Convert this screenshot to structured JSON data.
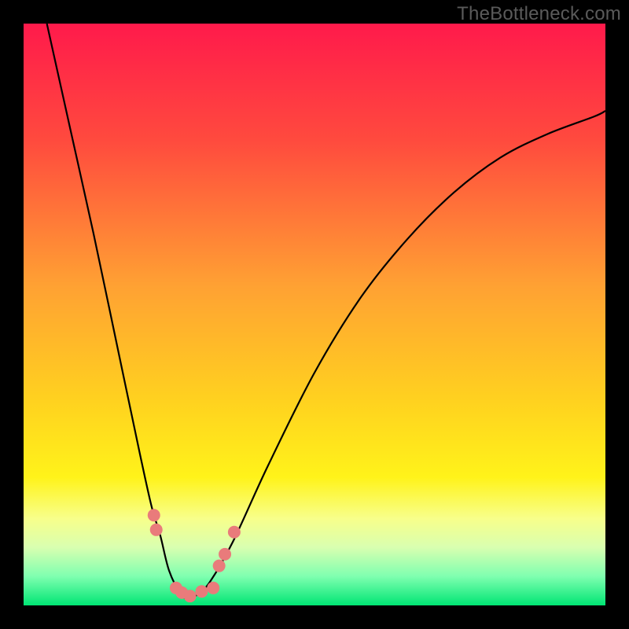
{
  "branding": {
    "watermark": "TheBottleneck.com"
  },
  "chart_data": {
    "type": "line",
    "title": "",
    "xlabel": "",
    "ylabel": "",
    "xlim": [
      0,
      100
    ],
    "ylim": [
      0,
      100
    ],
    "grid": false,
    "legend": false,
    "background_gradient": {
      "direction": "vertical",
      "stops": [
        {
          "offset": 0.0,
          "color": "#ff1a4b"
        },
        {
          "offset": 0.2,
          "color": "#ff4a3e"
        },
        {
          "offset": 0.45,
          "color": "#ffa133"
        },
        {
          "offset": 0.65,
          "color": "#ffd21f"
        },
        {
          "offset": 0.78,
          "color": "#fff31a"
        },
        {
          "offset": 0.85,
          "color": "#f8ff8a"
        },
        {
          "offset": 0.9,
          "color": "#d9ffb0"
        },
        {
          "offset": 0.95,
          "color": "#7fffb0"
        },
        {
          "offset": 1.0,
          "color": "#00e574"
        }
      ]
    },
    "series": [
      {
        "name": "bottleneck-curve",
        "color": "#000000",
        "x": [
          4,
          8,
          12,
          16,
          20,
          22,
          23.5,
          25,
          27,
          28.5,
          30,
          32,
          36,
          42,
          50,
          58,
          66,
          74,
          82,
          90,
          98,
          100
        ],
        "y": [
          100,
          82,
          64,
          45,
          26,
          17,
          12,
          6,
          2,
          1,
          2,
          4,
          11,
          24,
          40,
          53,
          63,
          71,
          77,
          81,
          84,
          85
        ]
      }
    ],
    "markers": [
      {
        "name": "marker-left-upper",
        "x": 22.4,
        "y": 15.5,
        "size": 8,
        "color": "#e97b7b"
      },
      {
        "name": "marker-left-lower",
        "x": 22.8,
        "y": 13.0,
        "size": 8,
        "color": "#e97b7b"
      },
      {
        "name": "marker-bottom-1",
        "x": 26.2,
        "y": 3.0,
        "size": 8,
        "color": "#e97b7b"
      },
      {
        "name": "marker-bottom-2",
        "x": 27.2,
        "y": 2.2,
        "size": 8,
        "color": "#e97b7b"
      },
      {
        "name": "marker-bottom-3",
        "x": 28.6,
        "y": 1.6,
        "size": 8,
        "color": "#e97b7b"
      },
      {
        "name": "marker-bottom-4",
        "x": 30.6,
        "y": 2.4,
        "size": 8,
        "color": "#e97b7b"
      },
      {
        "name": "marker-bottom-5",
        "x": 32.6,
        "y": 3.0,
        "size": 8,
        "color": "#e97b7b"
      },
      {
        "name": "marker-right-lower",
        "x": 33.6,
        "y": 6.8,
        "size": 8,
        "color": "#e97b7b"
      },
      {
        "name": "marker-right-upper",
        "x": 34.6,
        "y": 8.8,
        "size": 8,
        "color": "#e97b7b"
      },
      {
        "name": "marker-right-top",
        "x": 36.2,
        "y": 12.6,
        "size": 8,
        "color": "#e97b7b"
      }
    ]
  }
}
